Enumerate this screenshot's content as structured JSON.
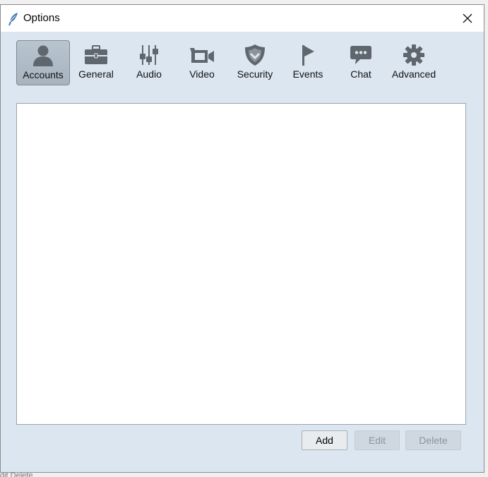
{
  "window": {
    "title": "Options",
    "app_icon": "feather-icon",
    "close_glyph": "✕"
  },
  "toolbar": {
    "selected": "Accounts",
    "items": [
      {
        "label": "Accounts",
        "icon": "user-silhouette-icon"
      },
      {
        "label": "General",
        "icon": "briefcase-icon"
      },
      {
        "label": "Audio",
        "icon": "equalizer-sliders-icon"
      },
      {
        "label": "Video",
        "icon": "video-camera-icon"
      },
      {
        "label": "Security",
        "icon": "shield-icon"
      },
      {
        "label": "Events",
        "icon": "flag-icon"
      },
      {
        "label": "Chat",
        "icon": "speech-bubble-icon"
      },
      {
        "label": "Advanced",
        "icon": "gear-icon"
      }
    ]
  },
  "accounts_list": {
    "items": []
  },
  "buttons": {
    "add": "Add",
    "edit": "Edit",
    "delete": "Delete"
  },
  "background_window": {
    "partial_text": "dit      Delete"
  },
  "colors": {
    "dialog_bg": "#dbe6f0",
    "icon_gray": "#5f666d",
    "disabled_text": "#8a949c"
  }
}
